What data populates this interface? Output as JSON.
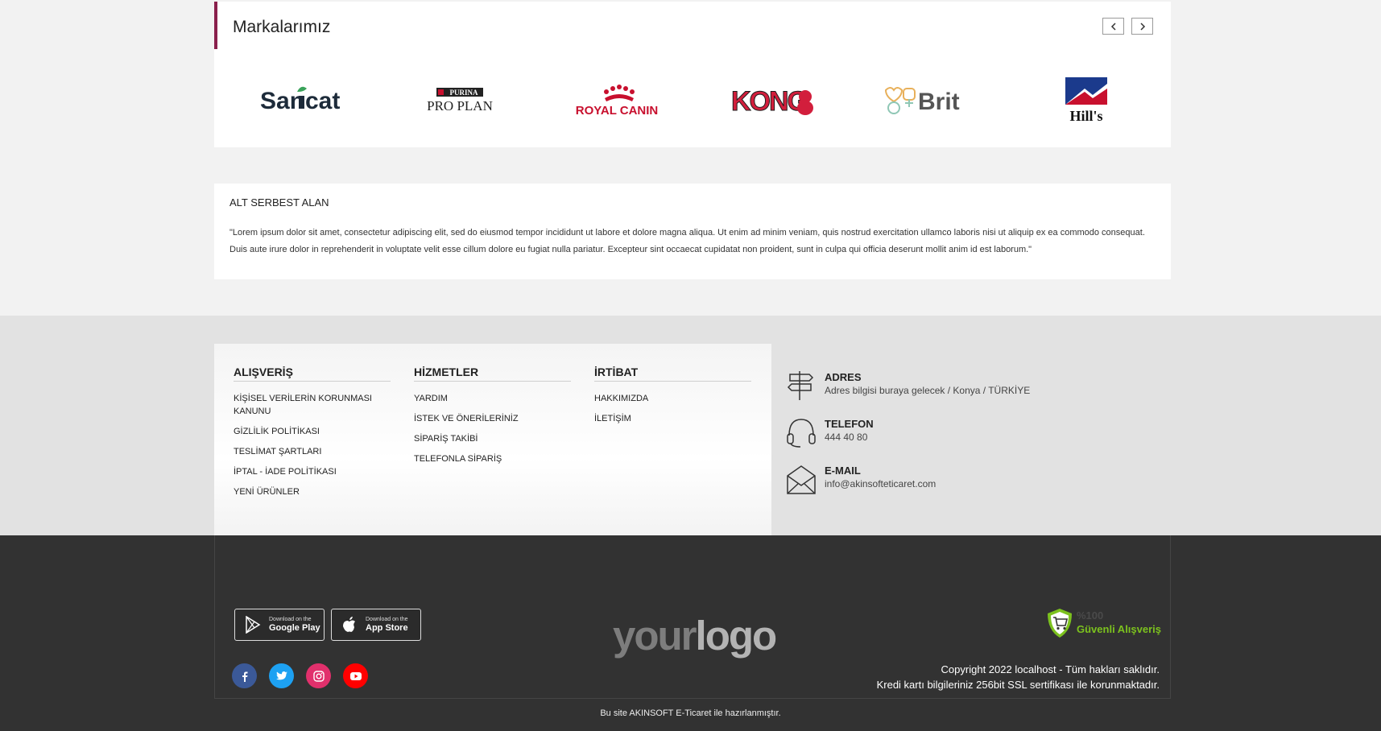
{
  "brands": {
    "title": "Markalarımız",
    "prev_label": "‹",
    "next_label": "›",
    "logos": [
      {
        "name": "Sanicat"
      },
      {
        "name": "Purina Pro Plan",
        "top": "PURINA",
        "main": "PRO PLAN"
      },
      {
        "name": "Royal Canin",
        "main": "ROYAL CANIN"
      },
      {
        "name": "Kong",
        "main": "KONG"
      },
      {
        "name": "Brit",
        "main": "Brit"
      },
      {
        "name": "Hill's",
        "main": "Hill's"
      }
    ]
  },
  "free_area": {
    "title": "ALT SERBEST ALAN",
    "text": "\"Lorem ipsum dolor sit amet, consectetur adipiscing elit, sed do eiusmod tempor incididunt ut labore et dolore magna aliqua. Ut enim ad minim veniam, quis nostrud exercitation ullamco laboris nisi ut aliquip ex ea commodo consequat. Duis aute irure dolor in reprehenderit in voluptate velit esse cillum dolore eu fugiat nulla pariatur. Excepteur sint occaecat cupidatat non proident, sunt in culpa qui officia deserunt mollit anim id est laborum.\""
  },
  "footer": {
    "columns": [
      {
        "title": "ALIŞVERİŞ",
        "items": [
          "KİŞİSEL VERİLERİN KORUNMASI KANUNU",
          "GİZLİLİK POLİTİKASI",
          "TESLİMAT ŞARTLARI",
          "İPTAL - İADE POLİTİKASI",
          "YENİ ÜRÜNLER"
        ]
      },
      {
        "title": "HİZMETLER",
        "items": [
          "YARDIM",
          "İSTEK VE ÖNERİLERİNİZ",
          "SİPARİŞ TAKİBİ",
          "TELEFONLA SİPARİŞ"
        ]
      },
      {
        "title": "İRTİBAT",
        "items": [
          "HAKKIMIZDA",
          "İLETİŞİM"
        ]
      }
    ],
    "contact": {
      "address_title": "ADRES",
      "address_value": "Adres bilgisi buraya gelecek / Konya / TÜRKİYE",
      "phone_title": "TELEFON",
      "phone_value": "444 40 80",
      "email_title": "E-MAIL",
      "email_value": "info@akinsofteticaret.com"
    }
  },
  "bottom": {
    "google_play": {
      "small": "Download on the",
      "big": "Google Play"
    },
    "app_store": {
      "small": "Download on the",
      "big": "App Store"
    },
    "social": [
      {
        "name": "facebook-icon",
        "color": "#3b5998"
      },
      {
        "name": "twitter-icon",
        "color": "#1da1f2"
      },
      {
        "name": "instagram-icon",
        "color": "#e1306c"
      },
      {
        "name": "youtube-icon",
        "color": "#ff0000"
      }
    ],
    "logo_your": "your",
    "logo_logo": "logo",
    "safe_percent": "%100",
    "safe_label": "Güvenli Alışveriş",
    "copyright": "Copyright 2022 localhost - Tüm hakları saklıdır.",
    "ssl": "Kredi kartı bilgileriniz 256bit SSL sertifikası ile korunmaktadır.",
    "credit": "Bu site AKINSOFT E-Ticaret ile hazırlanmıştır."
  },
  "colors": {
    "accent": "#8a1f4c",
    "footer_grey": "#e2e2e2",
    "footer_dark": "#323232",
    "safe_green": "#7cc21e"
  }
}
